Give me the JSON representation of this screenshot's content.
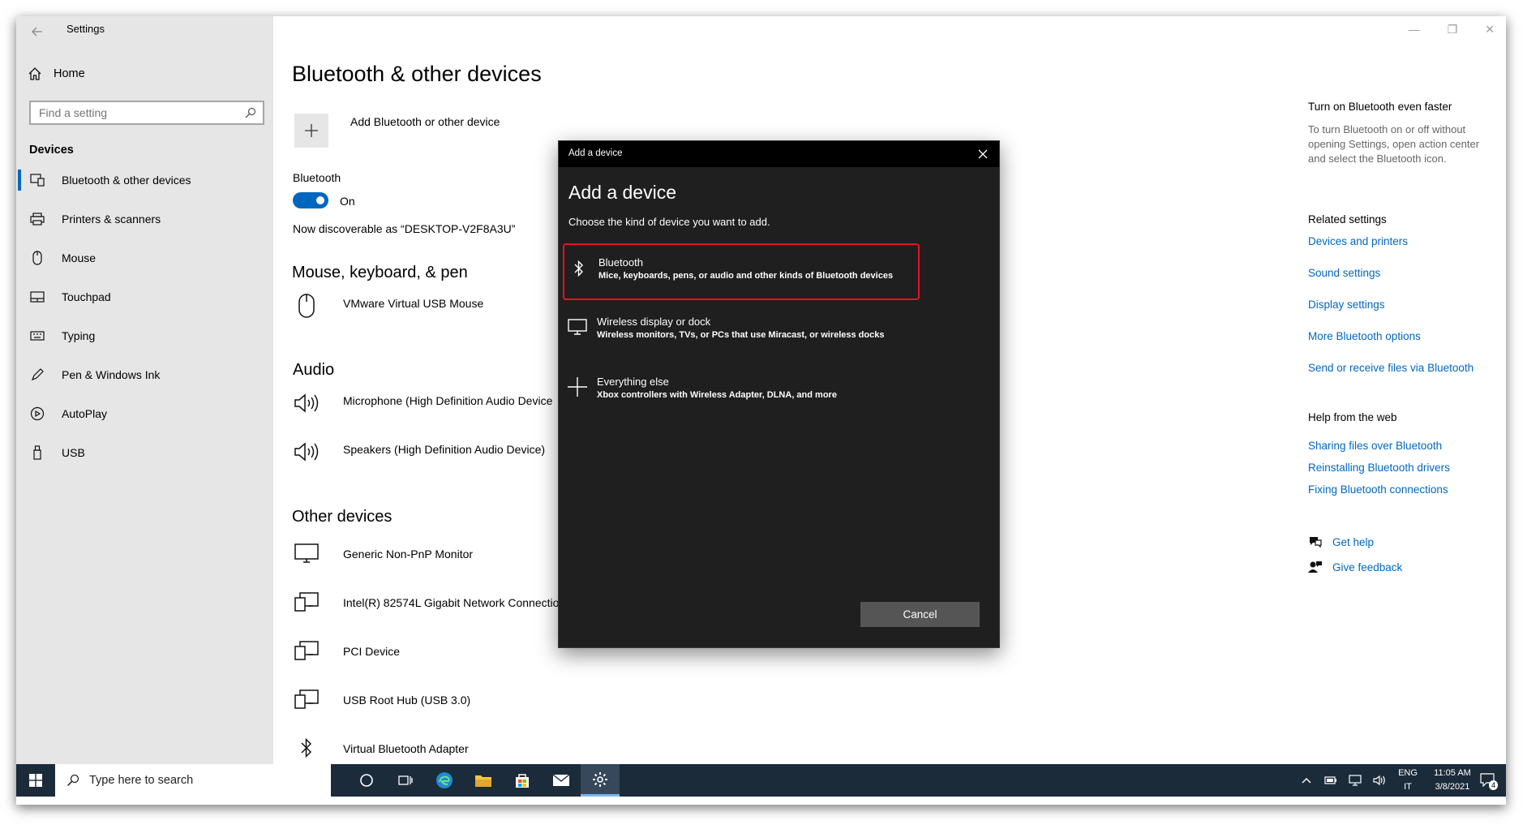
{
  "window": {
    "title": "Settings",
    "controls": [
      "—",
      "❐",
      "✕"
    ]
  },
  "sidebar": {
    "home_label": "Home",
    "search_placeholder": "Find a setting",
    "section_label": "Devices",
    "items": [
      {
        "label": "Bluetooth & other devices",
        "icon": "bluetooth-devices-icon",
        "active": true
      },
      {
        "label": "Printers & scanners",
        "icon": "printer-icon"
      },
      {
        "label": "Mouse",
        "icon": "mouse-icon"
      },
      {
        "label": "Touchpad",
        "icon": "touchpad-icon"
      },
      {
        "label": "Typing",
        "icon": "keyboard-icon"
      },
      {
        "label": "Pen & Windows Ink",
        "icon": "pen-icon"
      },
      {
        "label": "AutoPlay",
        "icon": "autoplay-icon"
      },
      {
        "label": "USB",
        "icon": "usb-icon"
      }
    ]
  },
  "main": {
    "title": "Bluetooth & other devices",
    "add_label": "Add Bluetooth or other device",
    "bluetooth_label": "Bluetooth",
    "toggle_state": "On",
    "discoverable": "Now discoverable as “DESKTOP-V2F8A3U”",
    "mouse_heading": "Mouse, keyboard, & pen",
    "mouse_device": "VMware Virtual USB Mouse",
    "audio_heading": "Audio",
    "audio_devices": [
      "Microphone (High Definition Audio Device",
      "Speakers (High Definition Audio Device)"
    ],
    "other_heading": "Other devices",
    "other_devices": [
      "Generic Non-PnP Monitor",
      "Intel(R) 82574L Gigabit Network Connectio",
      "PCI Device",
      "USB Root Hub (USB 3.0)",
      "Virtual Bluetooth Adapter"
    ]
  },
  "right": {
    "tip_heading": "Turn on Bluetooth even faster",
    "tip_text": "To turn Bluetooth on or off without opening Settings, open action center and select the Bluetooth icon.",
    "related_heading": "Related settings",
    "related_links": [
      "Devices and printers",
      "Sound settings",
      "Display settings",
      "More Bluetooth options",
      "Send or receive files via Bluetooth"
    ],
    "help_heading": "Help from the web",
    "help_links": [
      "Sharing files over Bluetooth",
      "Reinstalling Bluetooth drivers",
      "Fixing Bluetooth connections"
    ],
    "get_help": "Get help",
    "give_feedback": "Give feedback"
  },
  "dialog": {
    "titlebar": "Add a device",
    "heading": "Add a device",
    "subtitle": "Choose the kind of device you want to add.",
    "options": [
      {
        "title": "Bluetooth",
        "desc": "Mice, keyboards, pens, or audio and other kinds of Bluetooth devices",
        "highlighted": true
      },
      {
        "title": "Wireless display or dock",
        "desc": "Wireless monitors, TVs, or PCs that use Miracast, or wireless docks"
      },
      {
        "title": "Everything else",
        "desc": "Xbox controllers with Wireless Adapter, DLNA, and more"
      }
    ],
    "cancel_label": "Cancel",
    "highlight_color": "#e81123"
  },
  "taskbar": {
    "search_placeholder": "Type here to search",
    "lang_top": "ENG",
    "lang_bottom": "IT",
    "time": "11:05 AM",
    "date": "3/8/2021",
    "notification_count": "4"
  },
  "colors": {
    "accent": "#0067c0",
    "sidebar_bg": "#e6e6e6",
    "dialog_bg": "#1f1f1f",
    "taskbar_bg": "#1c2b3a"
  }
}
